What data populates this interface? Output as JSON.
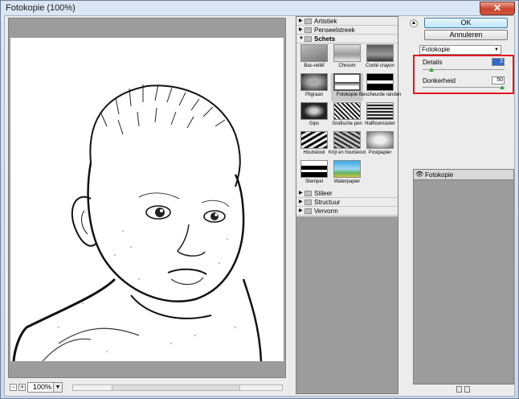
{
  "window": {
    "title": "Fotokopie (100%)",
    "close_glyph": "✕"
  },
  "preview": {
    "zoom": "100%",
    "zoom_minus": "-",
    "zoom_plus": "+"
  },
  "gallery": {
    "categories_top": [
      {
        "label": "Artistiek",
        "expanded": false
      },
      {
        "label": "Penseelstreek",
        "expanded": false
      },
      {
        "label": "Schets",
        "expanded": true
      }
    ],
    "filters": [
      "Bas-reliëf",
      "Chroom",
      "Conté crayon",
      "Pilgraan",
      "Fotokopie",
      "Bescheurde randen",
      "Gips",
      "Grafische pen",
      "Halftoonraster",
      "Houtskool",
      "Krijt en houtskool",
      "Postpapier",
      "Stempel",
      "Waterpapier"
    ],
    "selected_filter": "Fotokopie",
    "categories_bottom": [
      {
        "label": "Stileer",
        "expanded": false
      },
      {
        "label": "Structuur",
        "expanded": false
      },
      {
        "label": "Vervorm",
        "expanded": false
      }
    ]
  },
  "right": {
    "ok_label": "OK",
    "cancel_label": "Annuleren",
    "filter_select": "Fotokopie",
    "params": [
      {
        "label": "Details",
        "value": "2",
        "slider_fraction": 0.08
      },
      {
        "label": "Donkerheid",
        "value": "50",
        "slider_fraction": 1.0
      }
    ],
    "layers": [
      {
        "name": "Fotokopie",
        "visible": true
      }
    ]
  },
  "colors": {
    "highlight_box": "#e0181d",
    "slider_knob": "#3aa03a",
    "panel_gray": "#9c9c9c"
  }
}
